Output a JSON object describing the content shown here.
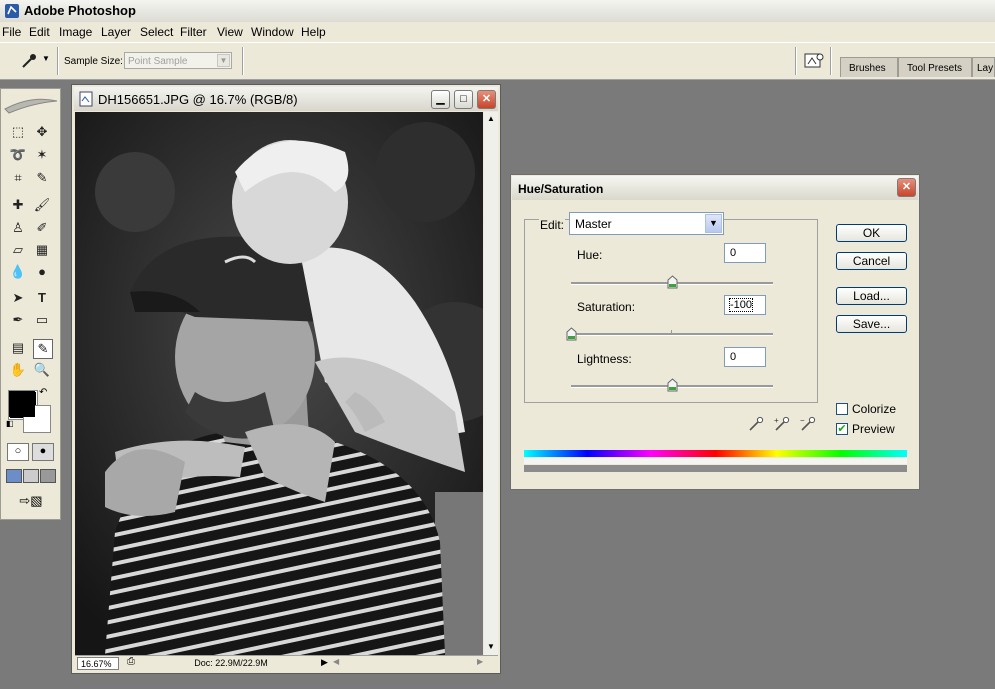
{
  "app": {
    "title": "Adobe Photoshop"
  },
  "menu": [
    "File",
    "Edit",
    "Image",
    "Layer",
    "Select",
    "Filter",
    "View",
    "Window",
    "Help"
  ],
  "options": {
    "sample_size_label": "Sample Size:",
    "sample_size_value": "Point Sample",
    "panel_tabs": [
      "Brushes",
      "Tool Presets",
      "Lay"
    ]
  },
  "document": {
    "title": "DH156651.JPG @ 16.7% (RGB/8)",
    "zoom": "16.67%",
    "doc_info": "Doc: 22.9M/22.9M"
  },
  "dialog": {
    "title": "Hue/Saturation",
    "edit_label": "Edit:",
    "edit_value": "Master",
    "hue_label": "Hue:",
    "hue_value": "0",
    "saturation_label": "Saturation:",
    "saturation_value": "-100",
    "lightness_label": "Lightness:",
    "lightness_value": "0",
    "buttons": {
      "ok": "OK",
      "cancel": "Cancel",
      "load": "Load...",
      "save": "Save..."
    },
    "colorize_label": "Colorize",
    "colorize_checked": false,
    "preview_label": "Preview",
    "preview_checked": true,
    "slider_positions": {
      "hue": 0.5,
      "saturation": 0.0,
      "lightness": 0.5
    }
  },
  "colors": {
    "xp_blue": "#003c74",
    "close_red": "#c7452b",
    "face": "#ece9d8"
  }
}
